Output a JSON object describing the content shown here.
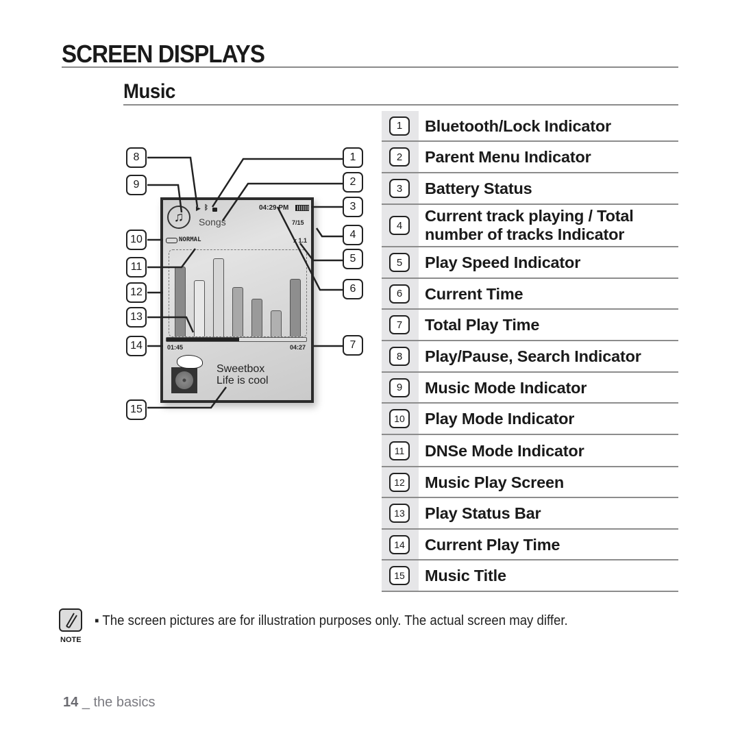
{
  "page": {
    "section_title": "SCREEN DISPLAYS",
    "subsection_title": "Music"
  },
  "device_screen": {
    "music_mode_icon": "music-note-icon",
    "play_indicator_icon": "play-icon",
    "bluetooth_icon": "bluetooth-icon",
    "lock_icon": "lock-icon",
    "parent_menu": "Songs",
    "clock": "04:29 PM",
    "battery_icon": "battery-full-icon",
    "track_counter": "7/15",
    "play_mode": "NORMAL",
    "play_mode_icon": "repeat-icon",
    "play_speed": "x 1.1",
    "current_play_time": "01:45",
    "total_play_time": "04:27",
    "progress": 0.52,
    "equalizer_levels": [
      0.85,
      0.68,
      0.95,
      0.6,
      0.46,
      0.32,
      0.7
    ],
    "artist": "Sweetbox",
    "title": "Life is cool"
  },
  "callouts": [
    "1",
    "2",
    "3",
    "4",
    "5",
    "6",
    "7",
    "8",
    "9",
    "10",
    "11",
    "12",
    "13",
    "14",
    "15"
  ],
  "legend": [
    {
      "num": "1",
      "label": "Bluetooth/Lock Indicator"
    },
    {
      "num": "2",
      "label": "Parent Menu Indicator"
    },
    {
      "num": "3",
      "label": "Battery Status"
    },
    {
      "num": "4",
      "label": "Current track playing / Total number of tracks Indicator"
    },
    {
      "num": "5",
      "label": "Play Speed Indicator"
    },
    {
      "num": "6",
      "label": "Current Time"
    },
    {
      "num": "7",
      "label": "Total Play Time"
    },
    {
      "num": "8",
      "label": "Play/Pause, Search Indicator"
    },
    {
      "num": "9",
      "label": "Music Mode Indicator"
    },
    {
      "num": "10",
      "label": "Play Mode Indicator"
    },
    {
      "num": "11",
      "label": "DNSe Mode Indicator"
    },
    {
      "num": "12",
      "label": "Music Play Screen"
    },
    {
      "num": "13",
      "label": "Play Status Bar"
    },
    {
      "num": "14",
      "label": "Current Play Time"
    },
    {
      "num": "15",
      "label": "Music Title"
    }
  ],
  "note": {
    "caption": "NOTE",
    "bullet": "▪",
    "text": "The screen pictures are for illustration purposes only. The actual screen may differ."
  },
  "footer": {
    "page_number": "14",
    "separator": "_",
    "section": "the basics"
  }
}
